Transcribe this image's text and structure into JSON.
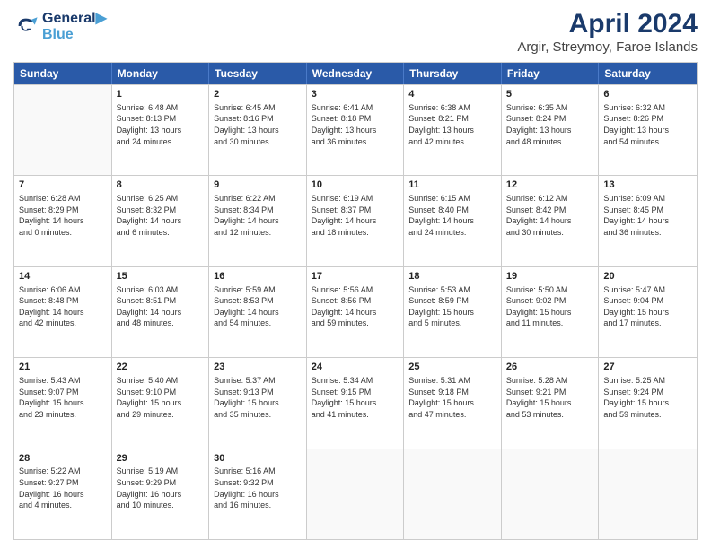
{
  "logo": {
    "line1": "General",
    "line2": "Blue"
  },
  "title": "April 2024",
  "subtitle": "Argir, Streymoy, Faroe Islands",
  "header_days": [
    "Sunday",
    "Monday",
    "Tuesday",
    "Wednesday",
    "Thursday",
    "Friday",
    "Saturday"
  ],
  "weeks": [
    [
      {
        "day": "",
        "lines": []
      },
      {
        "day": "1",
        "lines": [
          "Sunrise: 6:48 AM",
          "Sunset: 8:13 PM",
          "Daylight: 13 hours",
          "and 24 minutes."
        ]
      },
      {
        "day": "2",
        "lines": [
          "Sunrise: 6:45 AM",
          "Sunset: 8:16 PM",
          "Daylight: 13 hours",
          "and 30 minutes."
        ]
      },
      {
        "day": "3",
        "lines": [
          "Sunrise: 6:41 AM",
          "Sunset: 8:18 PM",
          "Daylight: 13 hours",
          "and 36 minutes."
        ]
      },
      {
        "day": "4",
        "lines": [
          "Sunrise: 6:38 AM",
          "Sunset: 8:21 PM",
          "Daylight: 13 hours",
          "and 42 minutes."
        ]
      },
      {
        "day": "5",
        "lines": [
          "Sunrise: 6:35 AM",
          "Sunset: 8:24 PM",
          "Daylight: 13 hours",
          "and 48 minutes."
        ]
      },
      {
        "day": "6",
        "lines": [
          "Sunrise: 6:32 AM",
          "Sunset: 8:26 PM",
          "Daylight: 13 hours",
          "and 54 minutes."
        ]
      }
    ],
    [
      {
        "day": "7",
        "lines": [
          "Sunrise: 6:28 AM",
          "Sunset: 8:29 PM",
          "Daylight: 14 hours",
          "and 0 minutes."
        ]
      },
      {
        "day": "8",
        "lines": [
          "Sunrise: 6:25 AM",
          "Sunset: 8:32 PM",
          "Daylight: 14 hours",
          "and 6 minutes."
        ]
      },
      {
        "day": "9",
        "lines": [
          "Sunrise: 6:22 AM",
          "Sunset: 8:34 PM",
          "Daylight: 14 hours",
          "and 12 minutes."
        ]
      },
      {
        "day": "10",
        "lines": [
          "Sunrise: 6:19 AM",
          "Sunset: 8:37 PM",
          "Daylight: 14 hours",
          "and 18 minutes."
        ]
      },
      {
        "day": "11",
        "lines": [
          "Sunrise: 6:15 AM",
          "Sunset: 8:40 PM",
          "Daylight: 14 hours",
          "and 24 minutes."
        ]
      },
      {
        "day": "12",
        "lines": [
          "Sunrise: 6:12 AM",
          "Sunset: 8:42 PM",
          "Daylight: 14 hours",
          "and 30 minutes."
        ]
      },
      {
        "day": "13",
        "lines": [
          "Sunrise: 6:09 AM",
          "Sunset: 8:45 PM",
          "Daylight: 14 hours",
          "and 36 minutes."
        ]
      }
    ],
    [
      {
        "day": "14",
        "lines": [
          "Sunrise: 6:06 AM",
          "Sunset: 8:48 PM",
          "Daylight: 14 hours",
          "and 42 minutes."
        ]
      },
      {
        "day": "15",
        "lines": [
          "Sunrise: 6:03 AM",
          "Sunset: 8:51 PM",
          "Daylight: 14 hours",
          "and 48 minutes."
        ]
      },
      {
        "day": "16",
        "lines": [
          "Sunrise: 5:59 AM",
          "Sunset: 8:53 PM",
          "Daylight: 14 hours",
          "and 54 minutes."
        ]
      },
      {
        "day": "17",
        "lines": [
          "Sunrise: 5:56 AM",
          "Sunset: 8:56 PM",
          "Daylight: 14 hours",
          "and 59 minutes."
        ]
      },
      {
        "day": "18",
        "lines": [
          "Sunrise: 5:53 AM",
          "Sunset: 8:59 PM",
          "Daylight: 15 hours",
          "and 5 minutes."
        ]
      },
      {
        "day": "19",
        "lines": [
          "Sunrise: 5:50 AM",
          "Sunset: 9:02 PM",
          "Daylight: 15 hours",
          "and 11 minutes."
        ]
      },
      {
        "day": "20",
        "lines": [
          "Sunrise: 5:47 AM",
          "Sunset: 9:04 PM",
          "Daylight: 15 hours",
          "and 17 minutes."
        ]
      }
    ],
    [
      {
        "day": "21",
        "lines": [
          "Sunrise: 5:43 AM",
          "Sunset: 9:07 PM",
          "Daylight: 15 hours",
          "and 23 minutes."
        ]
      },
      {
        "day": "22",
        "lines": [
          "Sunrise: 5:40 AM",
          "Sunset: 9:10 PM",
          "Daylight: 15 hours",
          "and 29 minutes."
        ]
      },
      {
        "day": "23",
        "lines": [
          "Sunrise: 5:37 AM",
          "Sunset: 9:13 PM",
          "Daylight: 15 hours",
          "and 35 minutes."
        ]
      },
      {
        "day": "24",
        "lines": [
          "Sunrise: 5:34 AM",
          "Sunset: 9:15 PM",
          "Daylight: 15 hours",
          "and 41 minutes."
        ]
      },
      {
        "day": "25",
        "lines": [
          "Sunrise: 5:31 AM",
          "Sunset: 9:18 PM",
          "Daylight: 15 hours",
          "and 47 minutes."
        ]
      },
      {
        "day": "26",
        "lines": [
          "Sunrise: 5:28 AM",
          "Sunset: 9:21 PM",
          "Daylight: 15 hours",
          "and 53 minutes."
        ]
      },
      {
        "day": "27",
        "lines": [
          "Sunrise: 5:25 AM",
          "Sunset: 9:24 PM",
          "Daylight: 15 hours",
          "and 59 minutes."
        ]
      }
    ],
    [
      {
        "day": "28",
        "lines": [
          "Sunrise: 5:22 AM",
          "Sunset: 9:27 PM",
          "Daylight: 16 hours",
          "and 4 minutes."
        ]
      },
      {
        "day": "29",
        "lines": [
          "Sunrise: 5:19 AM",
          "Sunset: 9:29 PM",
          "Daylight: 16 hours",
          "and 10 minutes."
        ]
      },
      {
        "day": "30",
        "lines": [
          "Sunrise: 5:16 AM",
          "Sunset: 9:32 PM",
          "Daylight: 16 hours",
          "and 16 minutes."
        ]
      },
      {
        "day": "",
        "lines": []
      },
      {
        "day": "",
        "lines": []
      },
      {
        "day": "",
        "lines": []
      },
      {
        "day": "",
        "lines": []
      }
    ]
  ]
}
